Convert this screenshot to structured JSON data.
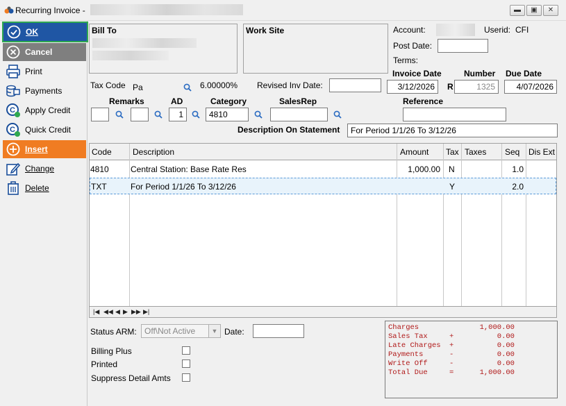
{
  "window": {
    "title": "Recurring Invoice -",
    "controls": [
      "minimize",
      "maximize",
      "close"
    ]
  },
  "sidebar": [
    {
      "key": "ok",
      "label": "OK"
    },
    {
      "key": "cancel",
      "label": "Cancel"
    },
    {
      "key": "print",
      "label": "Print"
    },
    {
      "key": "payments",
      "label": "Payments"
    },
    {
      "key": "apply_credit",
      "label": "Apply Credit"
    },
    {
      "key": "quick_credit",
      "label": "Quick Credit"
    },
    {
      "key": "insert",
      "label": "Insert"
    },
    {
      "key": "change",
      "label": "Change"
    },
    {
      "key": "delete",
      "label": "Delete"
    }
  ],
  "header": {
    "bill_to_label": "Bill To",
    "work_site_label": "Work Site",
    "account_label": "Account:",
    "userid_label": "Userid:",
    "userid_value": "CFI",
    "post_date_label": "Post Date:",
    "post_date_value": "",
    "terms_label": "Terms:",
    "invoice_date_label": "Invoice Date",
    "invoice_date_value": "3/12/2026",
    "number_label": "Number",
    "number_prefix": "R",
    "number_value": "1325",
    "due_date_label": "Due Date",
    "due_date_value": "4/07/2026",
    "tax_code_label": "Tax Code",
    "tax_code_value": "Pa",
    "tax_rate": "6.00000%",
    "revised_inv_date_label": "Revised Inv Date:",
    "revised_inv_date_value": "",
    "remarks_label": "Remarks",
    "ad_label": "AD",
    "ad_value": "1",
    "category_label": "Category",
    "category_value": "4810",
    "salesrep_label": "SalesRep",
    "reference_label": "Reference",
    "desc_on_statement_label": "Description On Statement",
    "desc_on_statement_value": "For Period 1/1/26 To 3/12/26"
  },
  "grid": {
    "columns": [
      "Code",
      "Description",
      "Amount",
      "Tax",
      "Taxes",
      "Seq",
      "Dis Ext"
    ],
    "rows": [
      {
        "code": "4810",
        "description": "Central Station: Base Rate Res",
        "amount": "1,000.00",
        "tax": "N",
        "taxes": "",
        "seq": "1.0",
        "dis_ext": ""
      },
      {
        "code": "TXT",
        "description": "For Period 1/1/26 To 3/12/26",
        "amount": "",
        "tax": "Y",
        "taxes": "",
        "seq": "2.0",
        "dis_ext": ""
      }
    ],
    "nav": [
      "|◀",
      "◀◀",
      "◀",
      "▶",
      "▶▶",
      "▶|"
    ]
  },
  "status": {
    "status_arm_label": "Status ARM:",
    "status_arm_value": "Off\\Not Active",
    "date_label": "Date:",
    "date_value": "",
    "billing_plus_label": "Billing Plus",
    "printed_label": "Printed",
    "suppress_label": "Suppress Detail Amts"
  },
  "summary": [
    {
      "label": "Charges",
      "op": "",
      "value": "1,000.00"
    },
    {
      "label": "Sales Tax",
      "op": "+",
      "value": "0.00"
    },
    {
      "label": "Late Charges",
      "op": "+",
      "value": "0.00"
    },
    {
      "label": "Payments",
      "op": "-",
      "value": "0.00"
    },
    {
      "label": "Write Off",
      "op": "-",
      "value": "0.00"
    },
    {
      "label": "Total Due",
      "op": "=",
      "value": "1,000.00"
    }
  ],
  "colors": {
    "ok_bg": "#1f56a4",
    "ok_border": "#2fa84f",
    "cancel_bg": "#7f7f7f",
    "insert_bg": "#f07c22",
    "summary_text": "#b01818",
    "icon_blue": "#1a4e9a"
  }
}
